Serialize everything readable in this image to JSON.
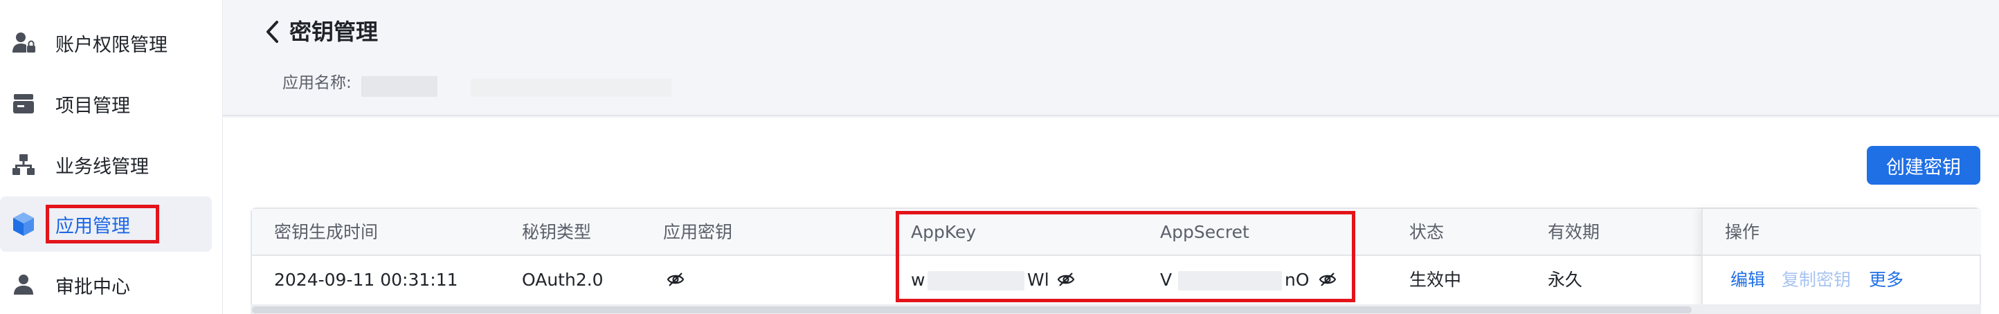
{
  "sidebar": {
    "items": [
      {
        "label": "账户权限管理",
        "icon": "user-lock-icon"
      },
      {
        "label": "项目管理",
        "icon": "folder-stack-icon"
      },
      {
        "label": "业务线管理",
        "icon": "org-tree-icon"
      },
      {
        "label": "应用管理",
        "icon": "cube-icon",
        "active": true
      },
      {
        "label": "审批中心",
        "icon": "person-icon"
      }
    ]
  },
  "header": {
    "title": "密钥管理",
    "app_name_label": "应用名称:"
  },
  "toolbar": {
    "create_label": "创建密钥"
  },
  "table": {
    "columns": [
      "密钥生成时间",
      "秘钥类型",
      "应用密钥",
      "AppKey",
      "AppSecret",
      "状态",
      "有效期",
      "操作"
    ],
    "rows": [
      {
        "created_at": "2024-09-11 00:31:11",
        "type": "OAuth2.0",
        "appkey_start": "w",
        "appkey_end": "Wl",
        "appsecret_start": "V",
        "appsecret_end": "nO",
        "status": "生效中",
        "validity": "永久",
        "actions": {
          "edit": "编辑",
          "copy": "复制密钥",
          "more": "更多"
        }
      }
    ]
  },
  "colors": {
    "accent": "#1f6fe5",
    "highlight": "#e3141b"
  }
}
